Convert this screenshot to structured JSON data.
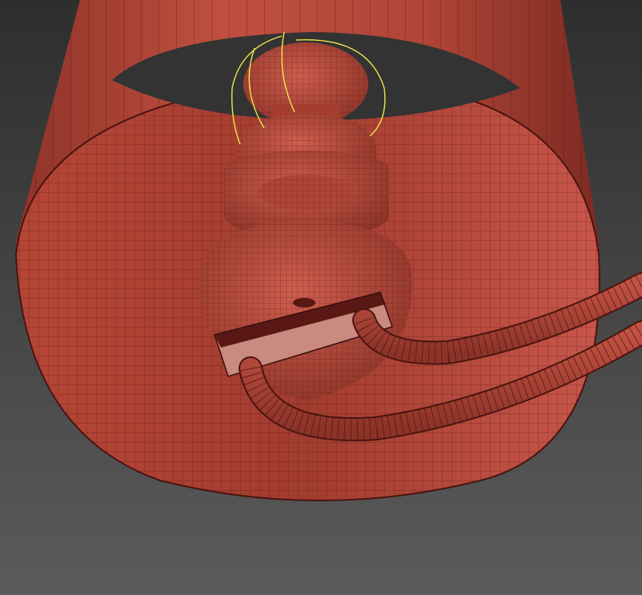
{
  "viewport": {
    "background_top": "#2f2f2f",
    "background_bottom": "#5a5a5a"
  },
  "colors": {
    "mesh_base": "#b5473a",
    "mesh_light": "#d2594a",
    "mesh_dark": "#7a2a22",
    "wire": "#4a1410",
    "plate": "#c98a80",
    "plate_dark": "#5a1814",
    "selection": "#f0e64a"
  },
  "objects": [
    {
      "name": "lamp-shade",
      "icon": "cylinder-icon"
    },
    {
      "name": "bulb-socket",
      "icon": "lathe-icon"
    },
    {
      "name": "mounting-plate",
      "icon": "box-icon"
    },
    {
      "name": "power-cable",
      "icon": "spline-icon"
    },
    {
      "name": "bulb-filament",
      "icon": "spline-icon",
      "selected": true
    }
  ]
}
